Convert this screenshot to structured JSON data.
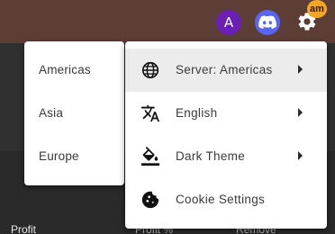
{
  "header": {
    "avatar_letter": "A",
    "badge_text": "am",
    "icons": [
      "discord-icon",
      "gear-icon"
    ]
  },
  "background": {
    "columns": [
      "Profit",
      "Profit %",
      "Remove"
    ]
  },
  "region_menu": {
    "items": [
      "Americas",
      "Asia",
      "Europe"
    ]
  },
  "settings_menu": {
    "items": [
      {
        "label": "Server: Americas",
        "icon": "globe-icon",
        "submenu": true,
        "active": true
      },
      {
        "label": "English",
        "icon": "translate-icon",
        "submenu": true,
        "active": false
      },
      {
        "label": "Dark Theme",
        "icon": "paint-bucket-icon",
        "submenu": true,
        "active": false
      },
      {
        "label": "Cookie Settings",
        "icon": "cookie-icon",
        "submenu": false,
        "active": false
      }
    ]
  },
  "colors": {
    "topbar": "#5d3e36",
    "avatar": "#6a1fb5",
    "discord": "#5865f2",
    "badge": "#f5a623",
    "menu_bg": "#ffffff",
    "active_item": "#ececec"
  }
}
